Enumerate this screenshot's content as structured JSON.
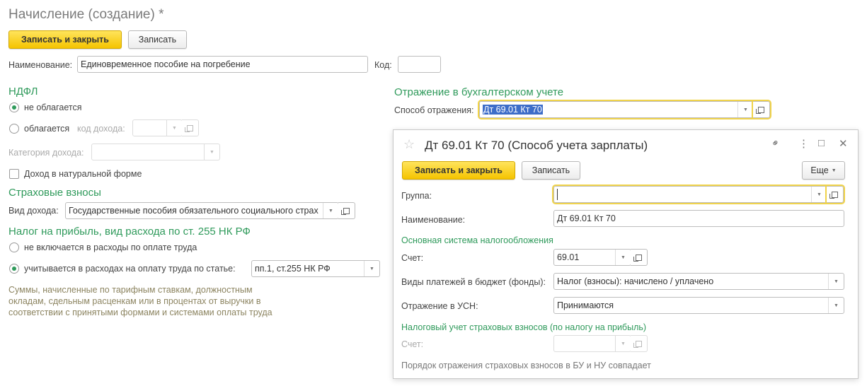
{
  "main": {
    "title": "Начисление (создание) *",
    "toolbar": {
      "save_close_label": "Записать и закрыть",
      "save_label": "Записать"
    },
    "name_label": "Наименование:",
    "name_value": "Единовременное пособие на погребение",
    "code_label": "Код:",
    "code_value": "",
    "ndfl": {
      "heading": "НДФЛ",
      "not_taxed_label": "не облагается",
      "not_taxed_selected": true,
      "taxed_label": "облагается",
      "taxed_selected": false,
      "income_code_label": "код дохода:",
      "income_code_value": "",
      "income_category_label": "Категория дохода:",
      "income_category_value": "",
      "in_kind_label": "Доход в натуральной форме",
      "in_kind_checked": false
    },
    "insurance": {
      "heading": "Страховые взносы",
      "income_type_label": "Вид дохода:",
      "income_type_value": "Государственные пособия обязательного социального страх"
    },
    "profit_tax": {
      "heading": "Налог на прибыль, вид расхода по ст. 255 НК РФ",
      "not_included_label": "не включается в расходы по оплате труда",
      "not_included_selected": false,
      "included_label": "учитывается в расходах на оплату труда по статье:",
      "included_selected": true,
      "article_value": "пп.1, ст.255 НК РФ",
      "hint": "Суммы, начисленные по тарифным ставкам, должностным окладам, сдельным расценкам или в процентах от выручки в соответствии с принятыми формами и системами оплаты труда"
    },
    "accounting": {
      "heading": "Отражение в бухгалтерском учете",
      "method_label": "Способ отражения:",
      "method_value": "Дт 69.01 Кт 70"
    }
  },
  "dialog": {
    "title": "Дт 69.01 Кт 70 (Способ учета зарплаты)",
    "toolbar": {
      "save_close_label": "Записать и закрыть",
      "save_label": "Записать",
      "more_label": "Еще"
    },
    "group_label": "Группа:",
    "group_value": "",
    "name_label": "Наименование:",
    "name_value": "Дт 69.01 Кт 70",
    "osn": {
      "heading": "Основная система налогообложения",
      "account_label": "Счет:",
      "account_value": "69.01",
      "payments_label": "Виды платежей в бюджет (фонды):",
      "payments_value": "Налог (взносы): начислено / уплачено",
      "usn_label": "Отражение в УСН:",
      "usn_value": "Принимаются"
    },
    "tax_insurance": {
      "heading": "Налоговый учет страховых взносов (по налогу на прибыль)",
      "account_label": "Счет:",
      "account_value": "",
      "note": "Порядок отражения страховых взносов в БУ и НУ совпадает"
    }
  },
  "icons": {
    "dropdown": "▼",
    "star": "☆",
    "link": "🔗",
    "more": "⋮",
    "maximize": "□",
    "close": "✕"
  }
}
